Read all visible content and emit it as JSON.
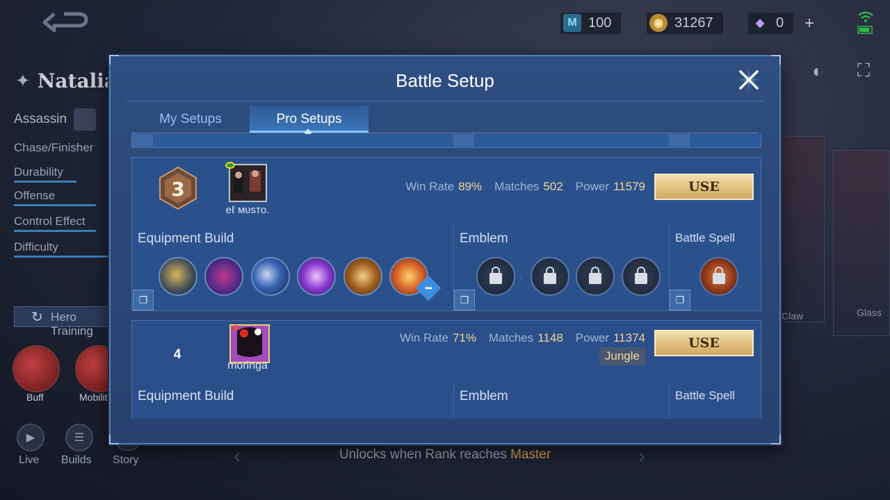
{
  "currency": {
    "tickets": "100",
    "battle_points": "31267",
    "diamonds": "0",
    "add": "+"
  },
  "hero": {
    "name": "Natalia",
    "role": "Assassin",
    "stats": [
      "Chase/Finisher",
      "Durability",
      "Offense",
      "Control Effect",
      "Difficulty"
    ],
    "hero_training": "Hero Training",
    "skills": [
      "Buff",
      "Mobility"
    ],
    "bottom_nav": [
      "Live",
      "Builds",
      "Story"
    ],
    "unlock_text_prefix": "Unlocks when Rank reaches ",
    "unlock_rank": "Master",
    "side_cards": [
      "Claw",
      "Glass"
    ]
  },
  "modal": {
    "title": "Battle Setup",
    "tabs": [
      "My Setups",
      "Pro Setups"
    ],
    "active_tab": "Pro Setups",
    "setups": [
      {
        "rank": "3",
        "player": "eℓ ᴍᴜsᴛᴏ.",
        "win_rate_label": "Win Rate",
        "win_rate": "89%",
        "matches_label": "Matches",
        "matches": "502",
        "power_label": "Power",
        "power": "11579",
        "use_label": "USE",
        "equipment_label": "Equipment Build",
        "emblem_label": "Emblem",
        "spell_label": "Battle Spell"
      },
      {
        "rank": "4",
        "player": "moringa",
        "win_rate_label": "Win Rate",
        "win_rate": "71%",
        "matches_label": "Matches",
        "matches": "1148",
        "power_label": "Power",
        "power": "11374",
        "tag": "Jungle",
        "use_label": "USE",
        "equipment_label": "Equipment Build",
        "emblem_label": "Emblem",
        "spell_label": "Battle Spell"
      }
    ]
  },
  "colors": {
    "modal_bg": "#2b518d",
    "accent_gold": "#e1c07e",
    "value_text": "#f2d49a",
    "tab_active": "#3c78bb"
  }
}
